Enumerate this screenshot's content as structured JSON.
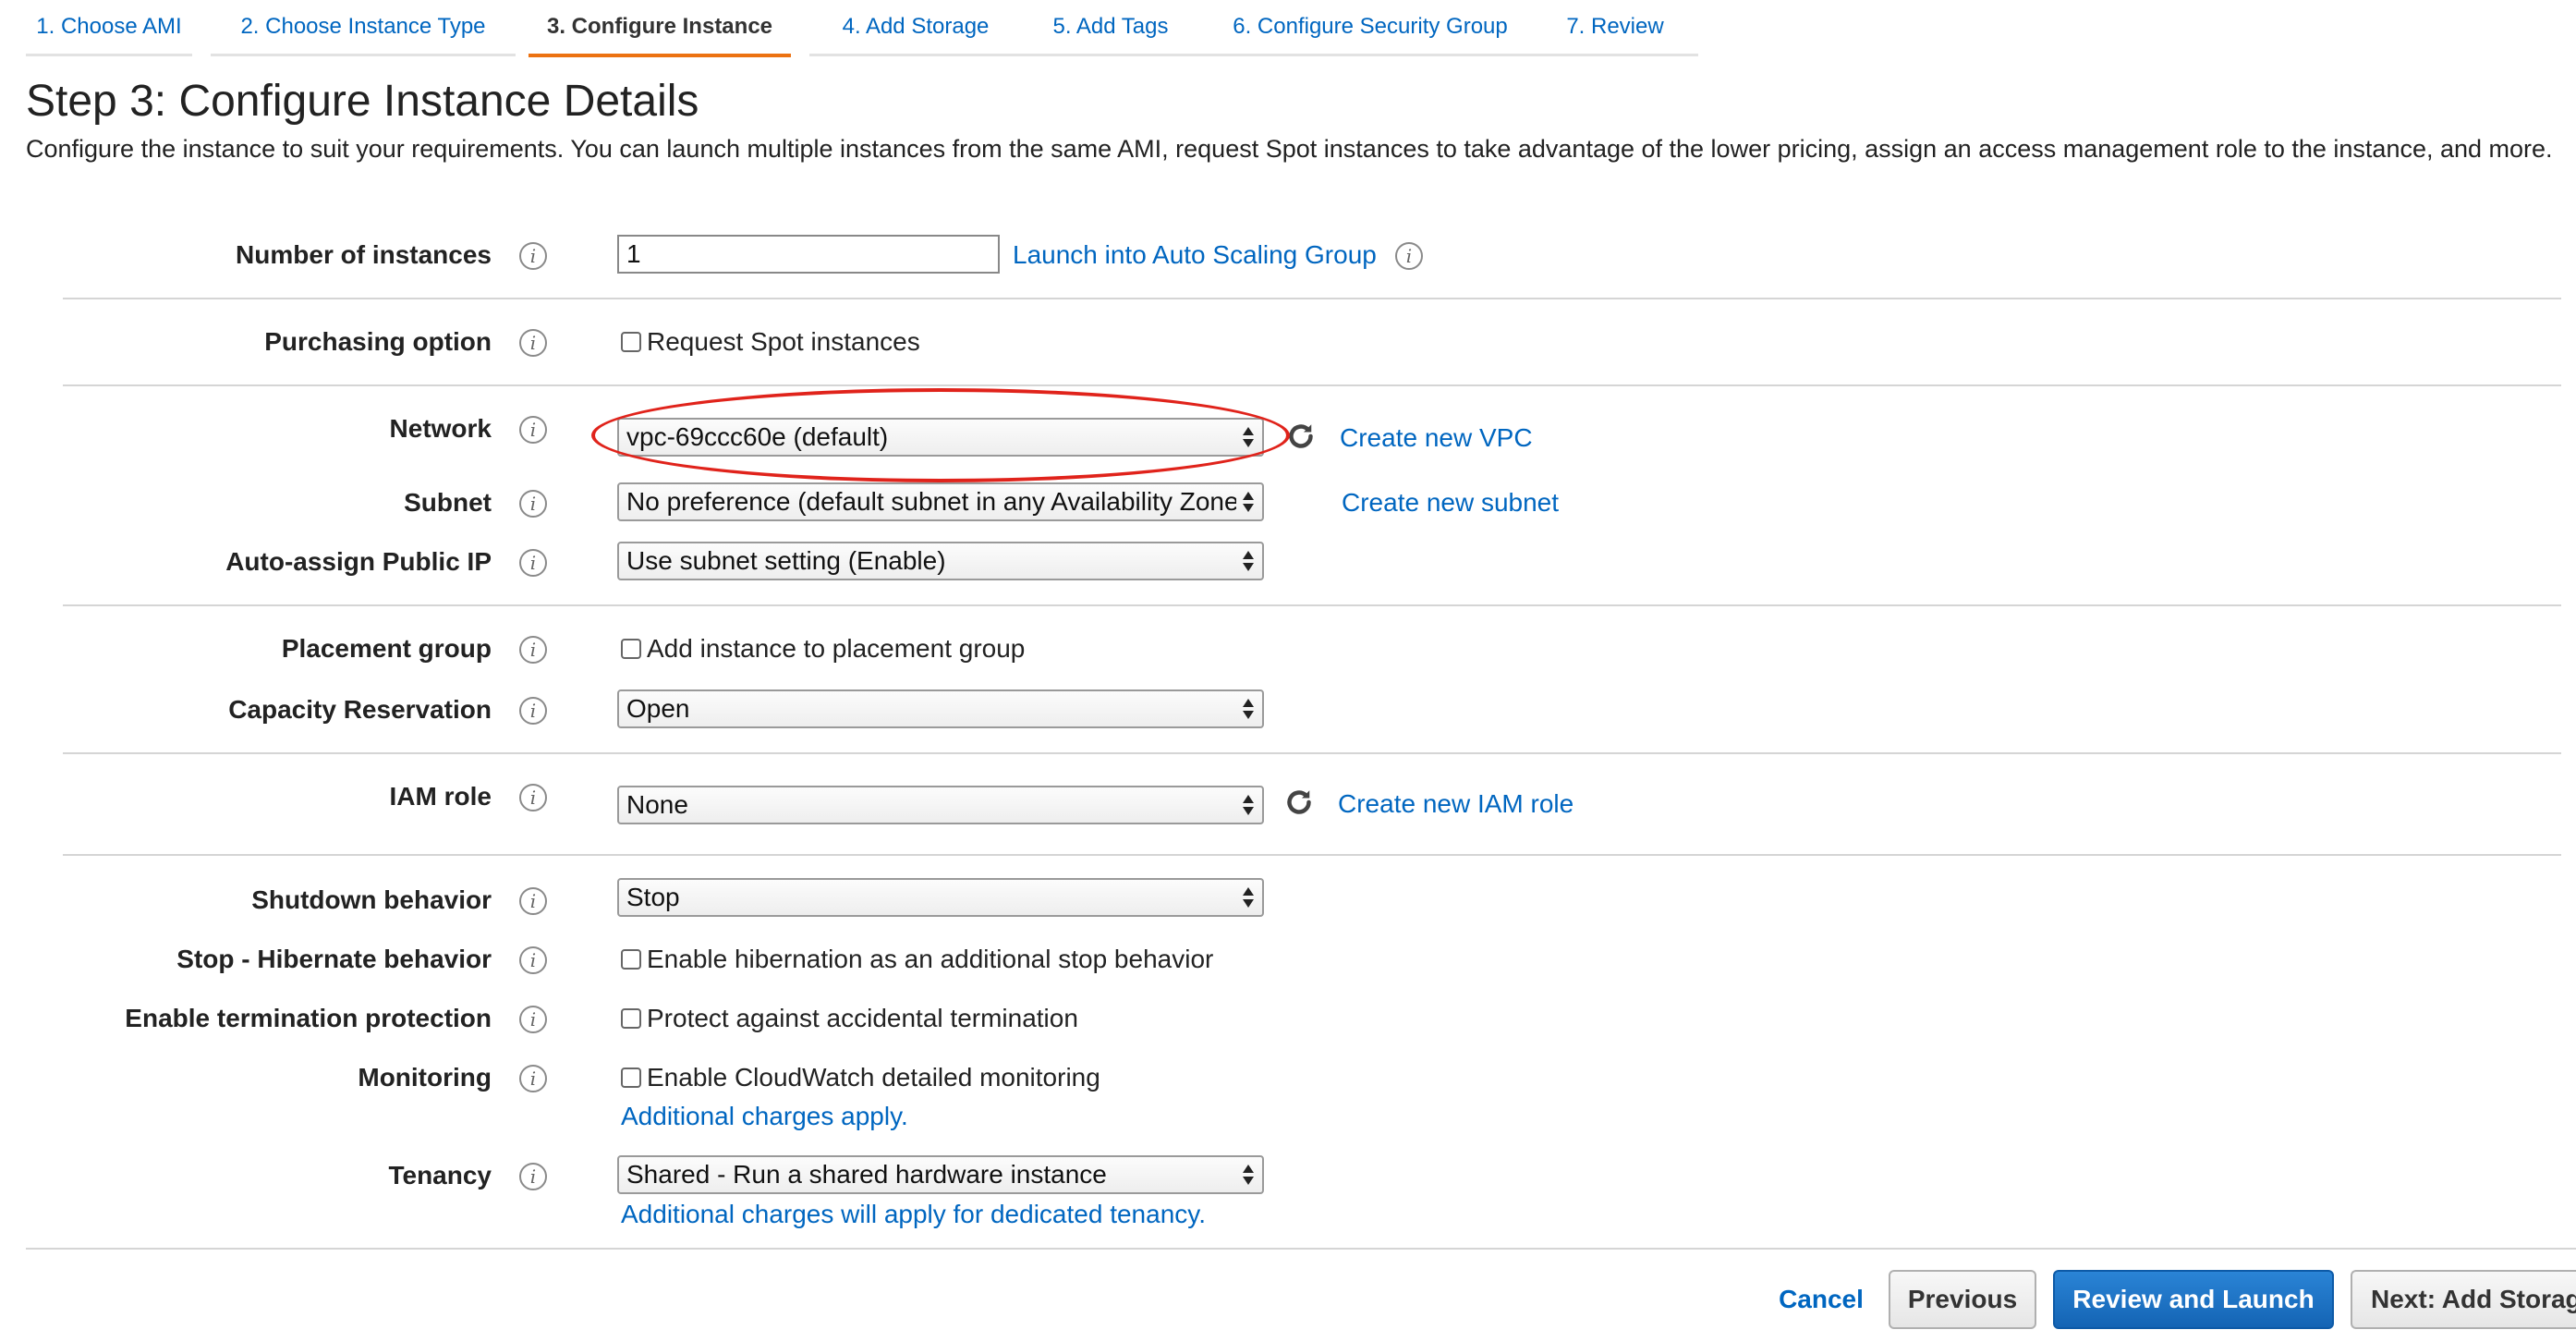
{
  "tabs": [
    {
      "label": "1. Choose AMI"
    },
    {
      "label": "2. Choose Instance Type"
    },
    {
      "label": "3. Configure Instance"
    },
    {
      "label": "4. Add Storage"
    },
    {
      "label": "5. Add Tags"
    },
    {
      "label": "6. Configure Security Group"
    },
    {
      "label": "7. Review"
    }
  ],
  "page": {
    "title": "Step 3: Configure Instance Details",
    "description": "Configure the instance to suit your requirements. You can launch multiple instances from the same AMI, request Spot instances to take advantage of the lower pricing, assign an access management role to the instance, and more."
  },
  "form": {
    "number_of_instances": {
      "label": "Number of instances",
      "value": "1",
      "link": "Launch into Auto Scaling Group"
    },
    "purchasing_option": {
      "label": "Purchasing option",
      "checkbox": "Request Spot instances"
    },
    "network": {
      "label": "Network",
      "value": "vpc-69ccc60e (default)",
      "link": "Create new VPC"
    },
    "subnet": {
      "label": "Subnet",
      "value": "No preference (default subnet in any Availability Zone)",
      "link": "Create new subnet"
    },
    "public_ip": {
      "label": "Auto-assign Public IP",
      "value": "Use subnet setting (Enable)"
    },
    "placement_group": {
      "label": "Placement group",
      "checkbox": "Add instance to placement group"
    },
    "capacity_reservation": {
      "label": "Capacity Reservation",
      "value": "Open"
    },
    "iam_role": {
      "label": "IAM role",
      "value": "None",
      "link": "Create new IAM role"
    },
    "shutdown_behavior": {
      "label": "Shutdown behavior",
      "value": "Stop"
    },
    "hibernate": {
      "label": "Stop - Hibernate behavior",
      "checkbox": "Enable hibernation as an additional stop behavior"
    },
    "termination_protection": {
      "label": "Enable termination protection",
      "checkbox": "Protect against accidental termination"
    },
    "monitoring": {
      "label": "Monitoring",
      "checkbox": "Enable CloudWatch detailed monitoring",
      "note": "Additional charges apply."
    },
    "tenancy": {
      "label": "Tenancy",
      "value": "Shared - Run a shared hardware instance",
      "note": "Additional charges will apply for dedicated tenancy."
    }
  },
  "footer": {
    "cancel": "Cancel",
    "previous": "Previous",
    "review": "Review and Launch",
    "next": "Next: Add Storage"
  },
  "colors": {
    "link": "#0066c0",
    "active_tab": "#ec7211",
    "primary_button": "#1a6fc4",
    "annotation": "#e0231b"
  }
}
